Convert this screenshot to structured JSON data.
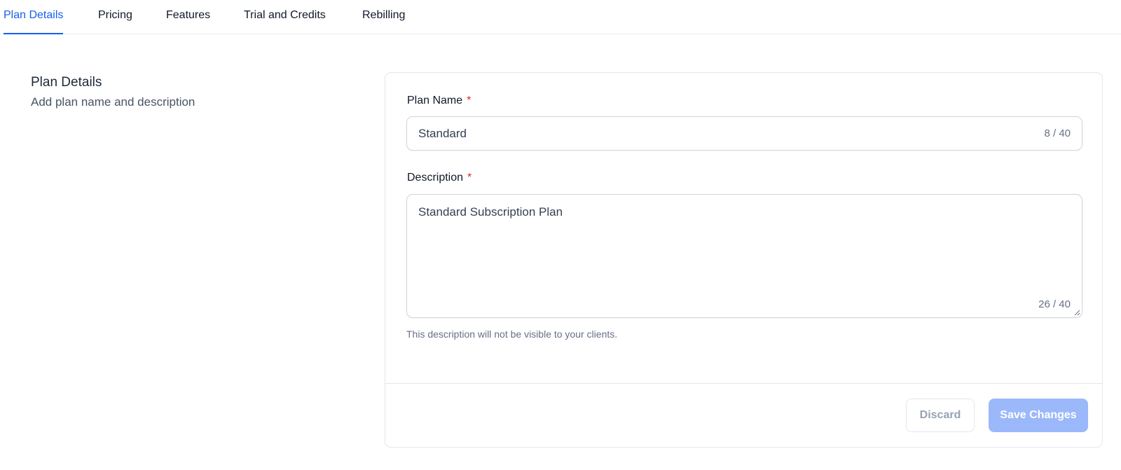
{
  "tabs": [
    {
      "label": "Plan Details",
      "active": true
    },
    {
      "label": "Pricing",
      "active": false
    },
    {
      "label": "Features",
      "active": false
    },
    {
      "label": "Trial and Credits",
      "active": false
    },
    {
      "label": "Rebilling",
      "active": false
    }
  ],
  "section": {
    "title": "Plan Details",
    "subtitle": "Add plan name and description"
  },
  "form": {
    "plan_name": {
      "label": "Plan Name",
      "required_mark": "*",
      "value": "Standard",
      "char_count": "8 / 40"
    },
    "description": {
      "label": "Description",
      "required_mark": "*",
      "value": "Standard Subscription Plan",
      "char_count": "26 / 40",
      "help_text": "This description will not be visible to your clients."
    }
  },
  "actions": {
    "discard_label": "Discard",
    "save_label": "Save Changes"
  },
  "colors": {
    "accent": "#155eef",
    "required": "#d92d20",
    "save_disabled_bg": "#9bb8fa"
  }
}
